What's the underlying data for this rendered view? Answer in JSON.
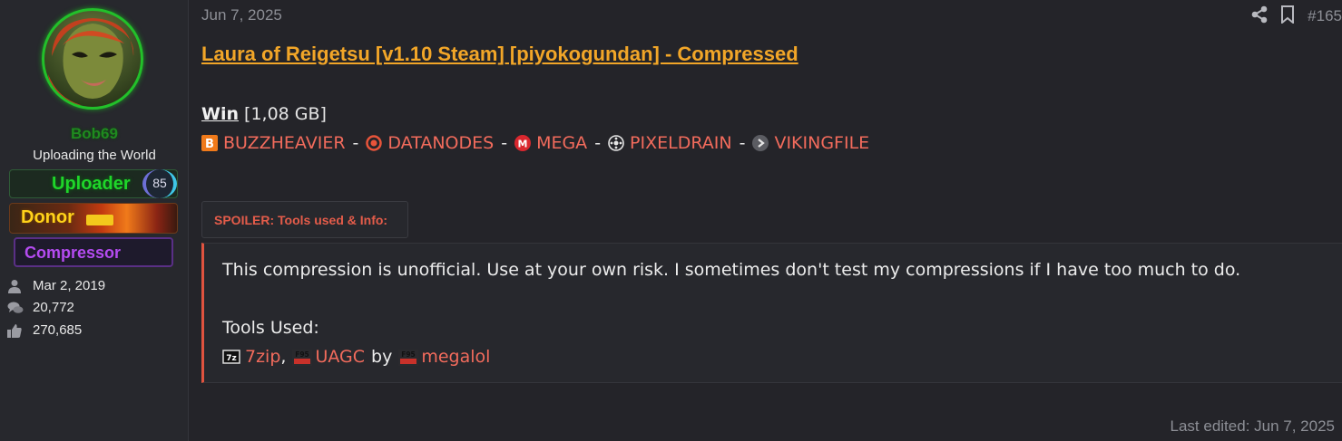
{
  "user": {
    "name": "Bob69",
    "title": "Uploading the World",
    "banners": {
      "uploader": "Uploader",
      "uploader_badge": "85",
      "donor": "Donor",
      "compressor": "Compressor"
    },
    "stats": {
      "joined": "Mar 2, 2019",
      "messages": "20,772",
      "reactions": "270,685"
    }
  },
  "post": {
    "date": "Jun 7, 2025",
    "number": "#165",
    "title": "Laura of Reigetsu [v1.10 Steam] [piyokogundan] - Compressed",
    "platform": "Win",
    "size": "[1,08 GB]",
    "links": [
      "BUZZHEAVIER",
      "DATANODES",
      "MEGA",
      "PIXELDRAIN",
      "VIKINGFILE"
    ],
    "separator": "-",
    "spoiler_label": "SPOILER: Tools used & Info:",
    "spoiler": {
      "disclaimer": "This compression is unofficial. Use at your own risk. I sometimes don't test my compressions if I have too much to do.",
      "tools_heading": "Tools Used:",
      "tool1": "7zip",
      "comma": ",",
      "tool2": "UAGC",
      "by": "by",
      "tool3": "megalol"
    },
    "last_edited": "Last edited: Jun 7, 2025"
  },
  "colors": {
    "link": "#f26b5c",
    "title": "#f2a628",
    "spoiler_accent": "#e0533f",
    "background": "#242429"
  },
  "icons": {
    "share": "share-icon",
    "bookmark": "bookmark-icon",
    "joined": "user-icon",
    "messages": "comments-icon",
    "reactions": "thumbs-up-icon"
  }
}
